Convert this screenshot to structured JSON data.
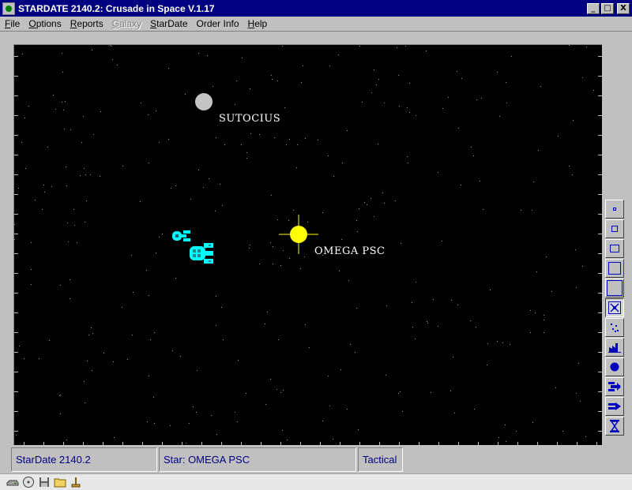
{
  "window": {
    "title": "STARDATE 2140.2: Crusade in Space V.1.17",
    "controls": {
      "minimize": "_",
      "maximize": "□",
      "close": "X"
    }
  },
  "menu": [
    {
      "label": "File",
      "mnemonic": "F",
      "rest": "ile",
      "enabled": true
    },
    {
      "label": "Options",
      "mnemonic": "O",
      "rest": "ptions",
      "enabled": true
    },
    {
      "label": "Reports",
      "mnemonic": "R",
      "rest": "eports",
      "enabled": true
    },
    {
      "label": "Galaxy",
      "mnemonic": "G",
      "rest": "alaxy",
      "enabled": false
    },
    {
      "label": "StarDate",
      "mnemonic": "S",
      "rest": "tarDate",
      "enabled": true
    },
    {
      "label": "Order Info",
      "mnemonic": "",
      "rest": "Order Info",
      "enabled": true
    },
    {
      "label": "Help",
      "mnemonic": "H",
      "rest": "elp",
      "enabled": true
    }
  ],
  "map": {
    "planet": {
      "name": "SUTOCIUS",
      "color": "#c4c4c4"
    },
    "star": {
      "name": "OMEGA PSC",
      "color": "#ffff00"
    },
    "fleet_color": "#00ffff"
  },
  "tools": [
    {
      "icon": "zoom-smallest-icon"
    },
    {
      "icon": "zoom-small-icon"
    },
    {
      "icon": "zoom-medium-icon"
    },
    {
      "icon": "zoom-large-icon"
    },
    {
      "icon": "zoom-largest-icon"
    },
    {
      "icon": "target-select-icon",
      "active": true
    },
    {
      "icon": "scatter-icon"
    },
    {
      "icon": "factory-icon"
    },
    {
      "icon": "planet-icon"
    },
    {
      "icon": "fleet-move-icon"
    },
    {
      "icon": "fleet-attack-icon"
    },
    {
      "icon": "hourglass-icon"
    }
  ],
  "status": {
    "stardate": "StarDate 2140.2",
    "star": "Star: OMEGA PSC",
    "mode": "Tactical"
  },
  "taskbar": [
    {
      "icon": "drive-icon"
    },
    {
      "icon": "cd-icon"
    },
    {
      "icon": "floppy-icon"
    },
    {
      "icon": "folder-icon"
    },
    {
      "icon": "tool-icon"
    }
  ],
  "colors": {
    "titlebar": "#000080",
    "status_text": "#000080",
    "button_icon": "#0000c0"
  }
}
